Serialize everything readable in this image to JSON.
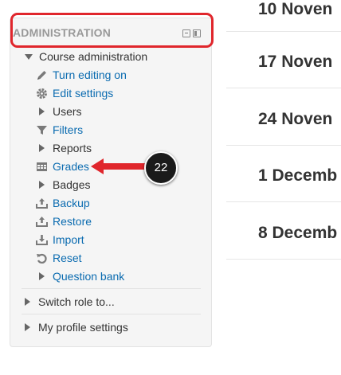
{
  "admin_block": {
    "title": "ADMINISTRATION",
    "course_admin": {
      "label": "Course administration",
      "items": [
        {
          "label": "Turn editing on",
          "icon": "pencil-icon",
          "link": true
        },
        {
          "label": "Edit settings",
          "icon": "gear-icon",
          "link": true
        },
        {
          "label": "Users",
          "icon": "expand-triangle",
          "link": false
        },
        {
          "label": "Filters",
          "icon": "filter-icon",
          "link": true
        },
        {
          "label": "Reports",
          "icon": "expand-triangle",
          "link": false
        },
        {
          "label": "Grades",
          "icon": "grades-table-icon",
          "link": true
        },
        {
          "label": "Badges",
          "icon": "expand-triangle",
          "link": false
        },
        {
          "label": "Backup",
          "icon": "backup-icon",
          "link": true
        },
        {
          "label": "Restore",
          "icon": "restore-icon",
          "link": true
        },
        {
          "label": "Import",
          "icon": "import-icon",
          "link": true
        },
        {
          "label": "Reset",
          "icon": "reset-icon",
          "link": true
        },
        {
          "label": "Question bank",
          "icon": "expand-triangle",
          "link": true
        }
      ]
    },
    "switch_role": "Switch role to...",
    "profile_settings": "My profile settings"
  },
  "annotation": {
    "step_number": "22",
    "highlight_color": "#e0262c",
    "arrow_color": "#e0262c",
    "badge_color": "#1a1a1a"
  },
  "dates": [
    "10 Noven",
    "17 Noven",
    "24 Noven",
    "1 Decemb",
    "8 Decemb"
  ],
  "colors": {
    "link": "#0a6bb0",
    "block_bg": "#f5f5f5",
    "title": "#999999"
  }
}
